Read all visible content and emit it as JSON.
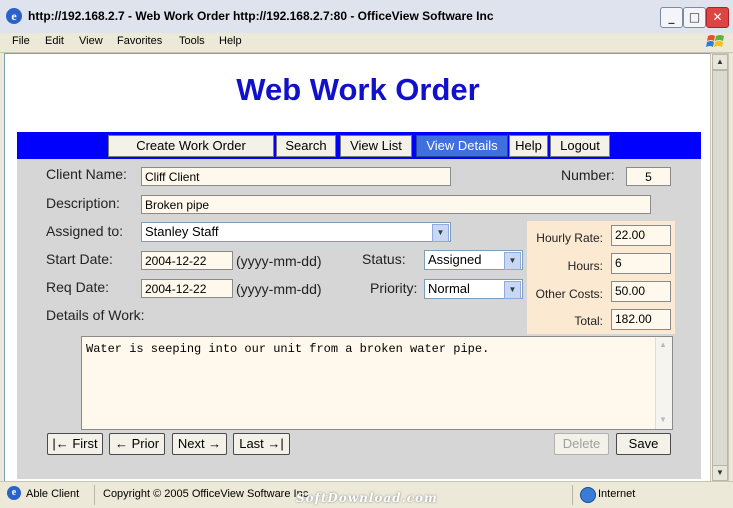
{
  "window": {
    "title": "http://192.168.2.7 - Web Work Order http://192.168.2.7:80 - OfficeView Software Inc",
    "minimize": "_",
    "maximize": "□",
    "close": "✕"
  },
  "menu": [
    "File",
    "Edit",
    "View",
    "Favorites",
    "Tools",
    "Help"
  ],
  "page": {
    "heading": "Web Work Order",
    "nav": [
      "Create Work Order",
      "Search",
      "View List",
      "View Details",
      "Help",
      "Logout"
    ],
    "nav_active": "View Details"
  },
  "form": {
    "client_name_label": "Client Name:",
    "client_name": "Cliff Client",
    "number_label": "Number:",
    "number": "5",
    "description_label": "Description:",
    "description": "Broken pipe",
    "assigned_label": "Assigned to:",
    "assigned": "Stanley Staff",
    "start_label": "Start Date:",
    "start_date": "2004-12-22",
    "start_format": "(yyyy-mm-dd)",
    "status_label": "Status:",
    "status": "Assigned",
    "req_label": "Req Date:",
    "req_date": "2004-12-22",
    "req_format": "(yyyy-mm-dd)",
    "priority_label": "Priority:",
    "priority": "Normal",
    "details_label": "Details of Work:",
    "details": "Water is seeping into our unit from a broken water pipe."
  },
  "costs": {
    "hourly_rate_label": "Hourly Rate:",
    "hourly_rate": "22.00",
    "hours_label": "Hours:",
    "hours": "6",
    "other_costs_label": "Other Costs:",
    "other_costs": "50.00",
    "total_label": "Total:",
    "total": "182.00"
  },
  "buttons": {
    "first": "|← First",
    "prior": "← Prior",
    "next": "Next →",
    "last": "Last →|",
    "delete": "Delete",
    "save": "Save"
  },
  "status_bar": {
    "user": "Able Client",
    "copyright": "Copyright © 2005 OfficeView Software Inc",
    "watermark": "SoftDownload.com",
    "zone": "Internet"
  },
  "colors": {
    "heading": "#1111cc",
    "nav_bar": "#0000ff",
    "nav_active": "#3f70de",
    "form_bg": "#d6d6d6",
    "cost_panel": "#fce9d2",
    "field_bg": "#fff8ec"
  },
  "icons": [
    "ie-page-icon",
    "windows-flag-icon",
    "globe-icon",
    "scroll-up-icon",
    "scroll-down-icon",
    "dropdown-arrow-icon"
  ]
}
